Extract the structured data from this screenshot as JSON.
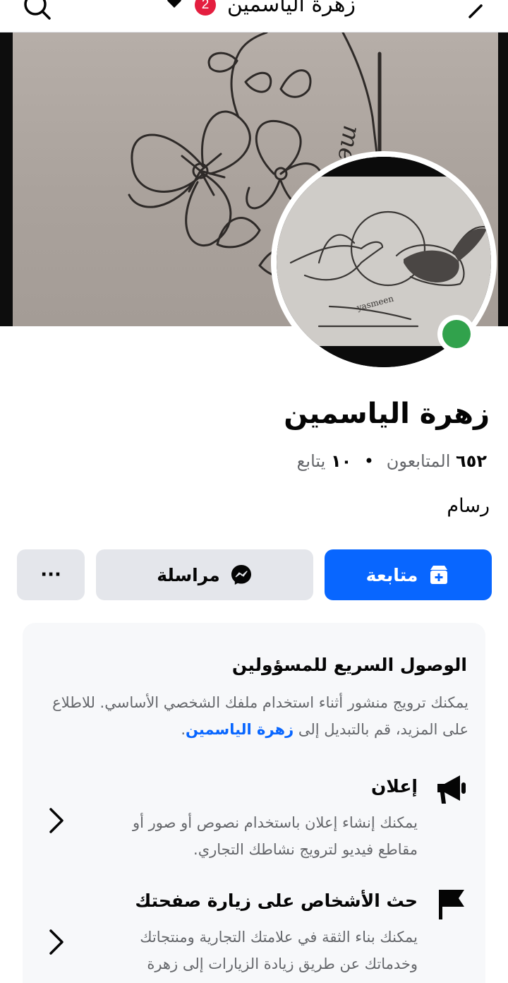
{
  "header": {
    "title": "زهرة الياسمين",
    "notification_count": "2",
    "icons": {
      "back": "chevron-left-icon",
      "search": "search-icon",
      "heart": "heart-icon"
    }
  },
  "profile": {
    "name": "زهرة الياسمين",
    "followers_count": "٦٥٢",
    "followers_label": "المتابعون",
    "following_count": "١٠",
    "following_label": "يتابع",
    "separator": "•",
    "category": "رسام",
    "online": true,
    "online_color": "#31a24c"
  },
  "actions": {
    "follow_label": "متابعة",
    "message_label": "مراسلة",
    "more_label": "···",
    "accent_color": "#0866ff"
  },
  "admin_card": {
    "title": "الوصول السريع للمسؤولين",
    "description_prefix": "يمكنك ترويج منشور أثناء استخدام ملفك الشخصي الأساسي. للاطلاع على المزيد، قم بالتبديل إلى",
    "description_link": "زهرة الياسمين",
    "description_suffix": ".",
    "items": [
      {
        "title": "إعلان",
        "description": "يمكنك إنشاء إعلان باستخدام نصوص أو صور أو مقاطع فيديو لترويج نشاطك التجاري.",
        "icon": "megaphone-icon"
      },
      {
        "title": "حث الأشخاص على زيارة صفحتك",
        "description": "يمكنك بناء الثقة في علامتك التجارية ومنتجاتك وخدماتك عن طريق زيادة الزيارات إلى زهرة الياسمين.",
        "icon": "flag-icon"
      }
    ]
  }
}
